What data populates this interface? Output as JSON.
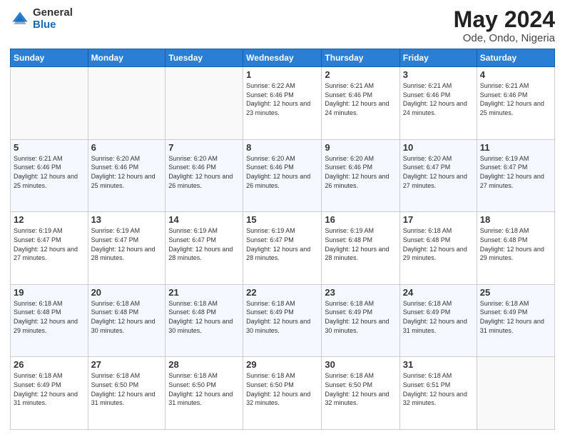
{
  "logo": {
    "general": "General",
    "blue": "Blue"
  },
  "header": {
    "month_year": "May 2024",
    "location": "Ode, Ondo, Nigeria"
  },
  "weekdays": [
    "Sunday",
    "Monday",
    "Tuesday",
    "Wednesday",
    "Thursday",
    "Friday",
    "Saturday"
  ],
  "weeks": [
    [
      {
        "day": "",
        "sunrise": "",
        "sunset": "",
        "daylight": ""
      },
      {
        "day": "",
        "sunrise": "",
        "sunset": "",
        "daylight": ""
      },
      {
        "day": "",
        "sunrise": "",
        "sunset": "",
        "daylight": ""
      },
      {
        "day": "1",
        "sunrise": "Sunrise: 6:22 AM",
        "sunset": "Sunset: 6:46 PM",
        "daylight": "Daylight: 12 hours and 23 minutes."
      },
      {
        "day": "2",
        "sunrise": "Sunrise: 6:21 AM",
        "sunset": "Sunset: 6:46 PM",
        "daylight": "Daylight: 12 hours and 24 minutes."
      },
      {
        "day": "3",
        "sunrise": "Sunrise: 6:21 AM",
        "sunset": "Sunset: 6:46 PM",
        "daylight": "Daylight: 12 hours and 24 minutes."
      },
      {
        "day": "4",
        "sunrise": "Sunrise: 6:21 AM",
        "sunset": "Sunset: 6:46 PM",
        "daylight": "Daylight: 12 hours and 25 minutes."
      }
    ],
    [
      {
        "day": "5",
        "sunrise": "Sunrise: 6:21 AM",
        "sunset": "Sunset: 6:46 PM",
        "daylight": "Daylight: 12 hours and 25 minutes."
      },
      {
        "day": "6",
        "sunrise": "Sunrise: 6:20 AM",
        "sunset": "Sunset: 6:46 PM",
        "daylight": "Daylight: 12 hours and 25 minutes."
      },
      {
        "day": "7",
        "sunrise": "Sunrise: 6:20 AM",
        "sunset": "Sunset: 6:46 PM",
        "daylight": "Daylight: 12 hours and 26 minutes."
      },
      {
        "day": "8",
        "sunrise": "Sunrise: 6:20 AM",
        "sunset": "Sunset: 6:46 PM",
        "daylight": "Daylight: 12 hours and 26 minutes."
      },
      {
        "day": "9",
        "sunrise": "Sunrise: 6:20 AM",
        "sunset": "Sunset: 6:46 PM",
        "daylight": "Daylight: 12 hours and 26 minutes."
      },
      {
        "day": "10",
        "sunrise": "Sunrise: 6:20 AM",
        "sunset": "Sunset: 6:47 PM",
        "daylight": "Daylight: 12 hours and 27 minutes."
      },
      {
        "day": "11",
        "sunrise": "Sunrise: 6:19 AM",
        "sunset": "Sunset: 6:47 PM",
        "daylight": "Daylight: 12 hours and 27 minutes."
      }
    ],
    [
      {
        "day": "12",
        "sunrise": "Sunrise: 6:19 AM",
        "sunset": "Sunset: 6:47 PM",
        "daylight": "Daylight: 12 hours and 27 minutes."
      },
      {
        "day": "13",
        "sunrise": "Sunrise: 6:19 AM",
        "sunset": "Sunset: 6:47 PM",
        "daylight": "Daylight: 12 hours and 28 minutes."
      },
      {
        "day": "14",
        "sunrise": "Sunrise: 6:19 AM",
        "sunset": "Sunset: 6:47 PM",
        "daylight": "Daylight: 12 hours and 28 minutes."
      },
      {
        "day": "15",
        "sunrise": "Sunrise: 6:19 AM",
        "sunset": "Sunset: 6:47 PM",
        "daylight": "Daylight: 12 hours and 28 minutes."
      },
      {
        "day": "16",
        "sunrise": "Sunrise: 6:19 AM",
        "sunset": "Sunset: 6:48 PM",
        "daylight": "Daylight: 12 hours and 28 minutes."
      },
      {
        "day": "17",
        "sunrise": "Sunrise: 6:18 AM",
        "sunset": "Sunset: 6:48 PM",
        "daylight": "Daylight: 12 hours and 29 minutes."
      },
      {
        "day": "18",
        "sunrise": "Sunrise: 6:18 AM",
        "sunset": "Sunset: 6:48 PM",
        "daylight": "Daylight: 12 hours and 29 minutes."
      }
    ],
    [
      {
        "day": "19",
        "sunrise": "Sunrise: 6:18 AM",
        "sunset": "Sunset: 6:48 PM",
        "daylight": "Daylight: 12 hours and 29 minutes."
      },
      {
        "day": "20",
        "sunrise": "Sunrise: 6:18 AM",
        "sunset": "Sunset: 6:48 PM",
        "daylight": "Daylight: 12 hours and 30 minutes."
      },
      {
        "day": "21",
        "sunrise": "Sunrise: 6:18 AM",
        "sunset": "Sunset: 6:48 PM",
        "daylight": "Daylight: 12 hours and 30 minutes."
      },
      {
        "day": "22",
        "sunrise": "Sunrise: 6:18 AM",
        "sunset": "Sunset: 6:49 PM",
        "daylight": "Daylight: 12 hours and 30 minutes."
      },
      {
        "day": "23",
        "sunrise": "Sunrise: 6:18 AM",
        "sunset": "Sunset: 6:49 PM",
        "daylight": "Daylight: 12 hours and 30 minutes."
      },
      {
        "day": "24",
        "sunrise": "Sunrise: 6:18 AM",
        "sunset": "Sunset: 6:49 PM",
        "daylight": "Daylight: 12 hours and 31 minutes."
      },
      {
        "day": "25",
        "sunrise": "Sunrise: 6:18 AM",
        "sunset": "Sunset: 6:49 PM",
        "daylight": "Daylight: 12 hours and 31 minutes."
      }
    ],
    [
      {
        "day": "26",
        "sunrise": "Sunrise: 6:18 AM",
        "sunset": "Sunset: 6:49 PM",
        "daylight": "Daylight: 12 hours and 31 minutes."
      },
      {
        "day": "27",
        "sunrise": "Sunrise: 6:18 AM",
        "sunset": "Sunset: 6:50 PM",
        "daylight": "Daylight: 12 hours and 31 minutes."
      },
      {
        "day": "28",
        "sunrise": "Sunrise: 6:18 AM",
        "sunset": "Sunset: 6:50 PM",
        "daylight": "Daylight: 12 hours and 31 minutes."
      },
      {
        "day": "29",
        "sunrise": "Sunrise: 6:18 AM",
        "sunset": "Sunset: 6:50 PM",
        "daylight": "Daylight: 12 hours and 32 minutes."
      },
      {
        "day": "30",
        "sunrise": "Sunrise: 6:18 AM",
        "sunset": "Sunset: 6:50 PM",
        "daylight": "Daylight: 12 hours and 32 minutes."
      },
      {
        "day": "31",
        "sunrise": "Sunrise: 6:18 AM",
        "sunset": "Sunset: 6:51 PM",
        "daylight": "Daylight: 12 hours and 32 minutes."
      },
      {
        "day": "",
        "sunrise": "",
        "sunset": "",
        "daylight": ""
      }
    ]
  ]
}
